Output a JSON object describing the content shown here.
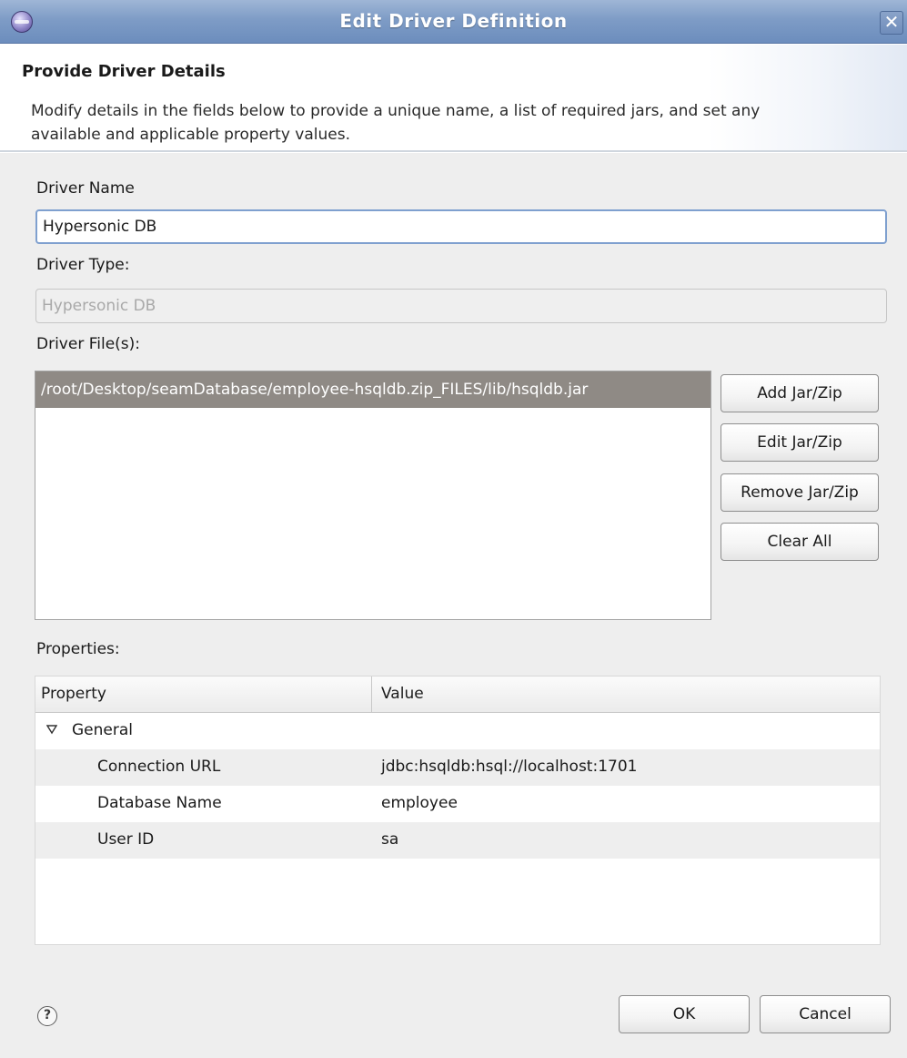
{
  "window": {
    "title": "Edit Driver Definition",
    "close_glyph": "✕"
  },
  "header": {
    "title": "Provide Driver Details",
    "description": "Modify details in the fields below to provide a unique name, a list of required jars, and set any available and applicable property values."
  },
  "form": {
    "driver_name_label": "Driver Name",
    "driver_name_value": "Hypersonic DB",
    "driver_type_label": "Driver Type:",
    "driver_type_value": "Hypersonic DB",
    "driver_files_label": "Driver File(s):",
    "driver_files": [
      "/root/Desktop/seamDatabase/employee-hsqldb.zip_FILES/lib/hsqldb.jar"
    ]
  },
  "file_buttons": {
    "add": "Add Jar/Zip",
    "edit": "Edit Jar/Zip",
    "remove": "Remove Jar/Zip",
    "clear": "Clear All"
  },
  "properties": {
    "label": "Properties:",
    "columns": [
      "Property",
      "Value"
    ],
    "group": "General",
    "rows": [
      {
        "name": "Connection URL",
        "value": "jdbc:hsqldb:hsql://localhost:1701"
      },
      {
        "name": "Database Name",
        "value": "employee"
      },
      {
        "name": "User ID",
        "value": "sa"
      }
    ]
  },
  "footer": {
    "help_glyph": "?",
    "ok": "OK",
    "cancel": "Cancel"
  },
  "colors": {
    "titlebar": "#7e9cc6",
    "selection": "#8f8a85",
    "field_focus_border": "#7fa0cf",
    "dialog_background": "#eeeeee"
  },
  "icons": [
    "app-icon",
    "close-icon",
    "expand-triangle-icon",
    "help-icon"
  ]
}
